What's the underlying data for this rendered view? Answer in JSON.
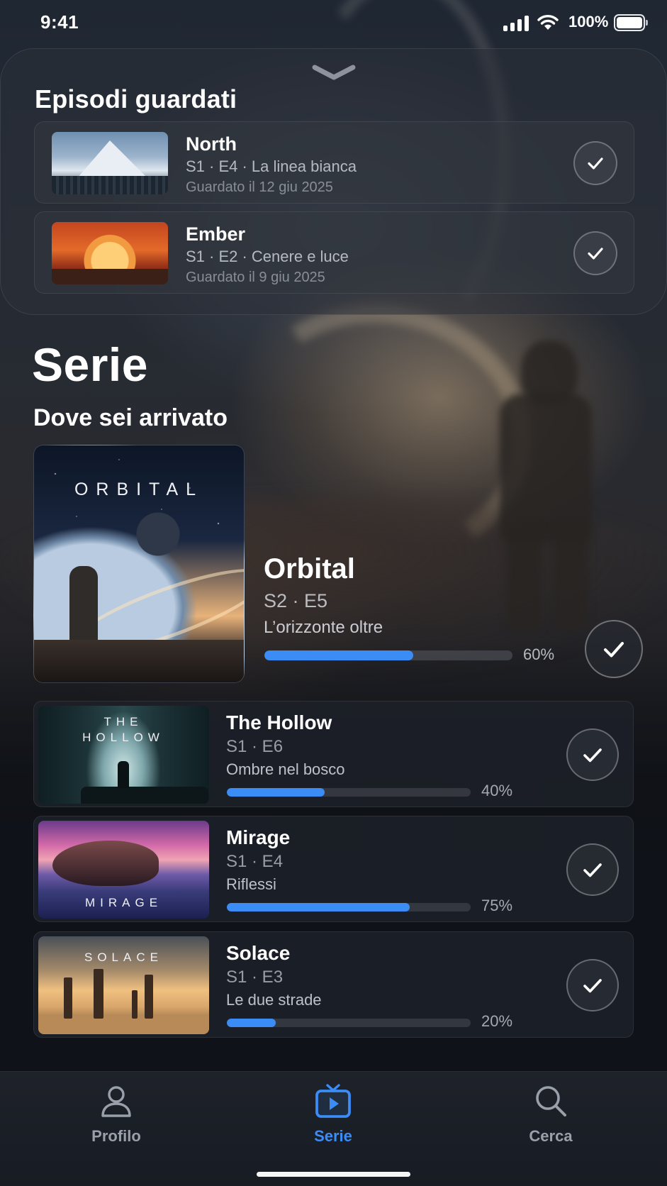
{
  "status_bar": {
    "time": "9:41",
    "battery": "100%"
  },
  "watched_sheet": {
    "title": "Episodi guardati",
    "items": [
      {
        "title": "North",
        "episode": "S1 · E4 · La linea bianca",
        "date": "Guardato il 12 giu 2025"
      },
      {
        "title": "Ember",
        "episode": "S1 · E2 · Cenere e luce",
        "date": "Guardato il 9 giu 2025"
      }
    ]
  },
  "page": {
    "title": "Serie",
    "section_title": "Dove sei arrivato"
  },
  "featured": {
    "poster_text": "ORBITAL",
    "title": "Orbital",
    "episode": "S2 · E5",
    "episode_name": "L’orizzonte oltre",
    "progress": 60,
    "progress_label": "60%"
  },
  "continue_list": [
    {
      "poster_text": "THE HOLLOW",
      "title": "The Hollow",
      "episode": "S1 · E6",
      "episode_name": "Ombre nel bosco",
      "progress": 40,
      "progress_label": "40%"
    },
    {
      "poster_text": "MIRAGE",
      "title": "Mirage",
      "episode": "S1 · E4",
      "episode_name": "Riflessi",
      "progress": 75,
      "progress_label": "75%"
    },
    {
      "poster_text": "SOLACE",
      "title": "Solace",
      "episode": "S1 · E3",
      "episode_name": "Le due strade",
      "progress": 20,
      "progress_label": "20%"
    }
  ],
  "tab_bar": {
    "tabs": [
      {
        "label": "Profilo",
        "icon": "person-icon",
        "active": false
      },
      {
        "label": "Serie",
        "icon": "tv-play-icon",
        "active": true
      },
      {
        "label": "Cerca",
        "icon": "search-icon",
        "active": false
      }
    ]
  },
  "colors": {
    "accent": "#3b8cf5",
    "background": "#0e1218"
  }
}
